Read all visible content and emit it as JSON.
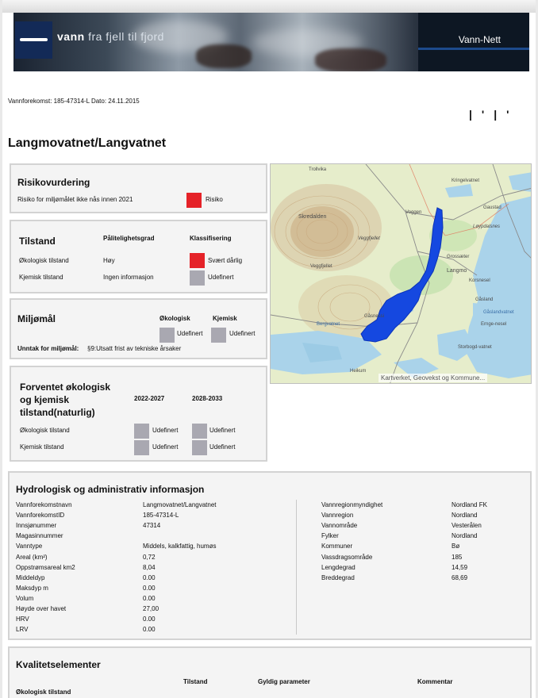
{
  "banner": {
    "logo_bold": "vann",
    "logo_light": "fra fjell til fjord",
    "app_name": "Vann-Nett"
  },
  "meta_line": "Vannforekomst: 185-47314-L Dato: 24.11.2015",
  "title": "Langmovatnet/Langvatnet",
  "risk": {
    "title": "Risikovurdering",
    "label": "Risiko for miljømålet ikke nås innen 2021",
    "value": "Risiko",
    "color": "#e52228"
  },
  "tilstand": {
    "title": "Tilstand",
    "col_reliability": "Pålitelighetsgrad",
    "col_class": "Klassifisering",
    "rows": [
      {
        "label": "Økologisk tilstand",
        "reliability": "Høy",
        "class": "Svært dårlig",
        "color": "#e52228"
      },
      {
        "label": "Kjemisk tilstand",
        "reliability": "Ingen informasjon",
        "class": "Udefinert",
        "color": "#a9a8b1"
      }
    ]
  },
  "miljomal": {
    "title": "Miljømål",
    "col_eco": "Økologisk",
    "col_chem": "Kjemisk",
    "eco_value": "Udefinert",
    "chem_value": "Udefinert",
    "exception_label": "Unntak for miljømål:",
    "exception_value": "§9:Utsatt frist av tekniske årsaker"
  },
  "forventet": {
    "title_line1": "Forventet økologisk",
    "title_line2": "og kjemisk",
    "title_line3": "tilstand(naturlig)",
    "col_1": "2022-2027",
    "col_2": "2028-2033",
    "rows": [
      {
        "label": "Økologisk tilstand",
        "v1": "Udefinert",
        "v2": "Udefinert"
      },
      {
        "label": "Kjemisk tilstand",
        "v1": "Udefinert",
        "v2": "Udefinert"
      }
    ]
  },
  "map": {
    "attribution": "Kartverket, Geovekst og Kommune...",
    "place_names": [
      "Trollvika",
      "Kringelvatnet",
      "Skredalden",
      "Voggen",
      "Gaustad",
      "Løypdalsnes",
      "Veggfjellet",
      "Veggfjellet",
      "Grossæter",
      "Langmo",
      "Korsnesel",
      "Gåsland",
      "Gåslandvatnet",
      "Ernge-nesel",
      "Bergvatnet",
      "Gåsnessi",
      "Storbogd-vatnet",
      "Heikum"
    ]
  },
  "hydro": {
    "title": "Hydrologisk og administrativ informasjon",
    "left": [
      {
        "label": "Vannforekomstnavn",
        "value": "Langmovatnet/Langvatnet"
      },
      {
        "label": "VannforekomstID",
        "value": "185-47314-L"
      },
      {
        "label": "Innsjønummer",
        "value": "47314"
      },
      {
        "label": "Magasinnummer",
        "value": ""
      },
      {
        "label": "Vanntype",
        "value": "Middels, kalkfattig, humøs"
      },
      {
        "label": "Areal (km²)",
        "value": "0,72"
      },
      {
        "label": "Oppstrømsareal km2",
        "value": "8,04"
      },
      {
        "label": "Middeldyp",
        "value": "0.00"
      },
      {
        "label": "Maksdyp m",
        "value": "0.00"
      },
      {
        "label": "Volum",
        "value": "0.00"
      },
      {
        "label": "Høyde over havet",
        "value": "27,00"
      },
      {
        "label": "HRV",
        "value": "0.00"
      },
      {
        "label": "LRV",
        "value": "0.00"
      }
    ],
    "right": [
      {
        "label": "Vannregionmyndighet",
        "value": "Nordland FK"
      },
      {
        "label": "Vannregion",
        "value": "Nordland"
      },
      {
        "label": "Vannområde",
        "value": "Vesterålen"
      },
      {
        "label": "Fylker",
        "value": "Nordland"
      },
      {
        "label": "Kommuner",
        "value": "Bø"
      },
      {
        "label": "Vassdragsområde",
        "value": "185"
      },
      {
        "label": "Lengdegrad",
        "value": "14,59"
      },
      {
        "label": "Breddegrad",
        "value": "68,69"
      }
    ]
  },
  "kvalitet": {
    "title": "Kvalitetselementer",
    "col_tilstand": "Tilstand",
    "col_param": "Gyldig parameter",
    "col_comment": "Kommentar",
    "section": "Økologisk tilstand"
  }
}
